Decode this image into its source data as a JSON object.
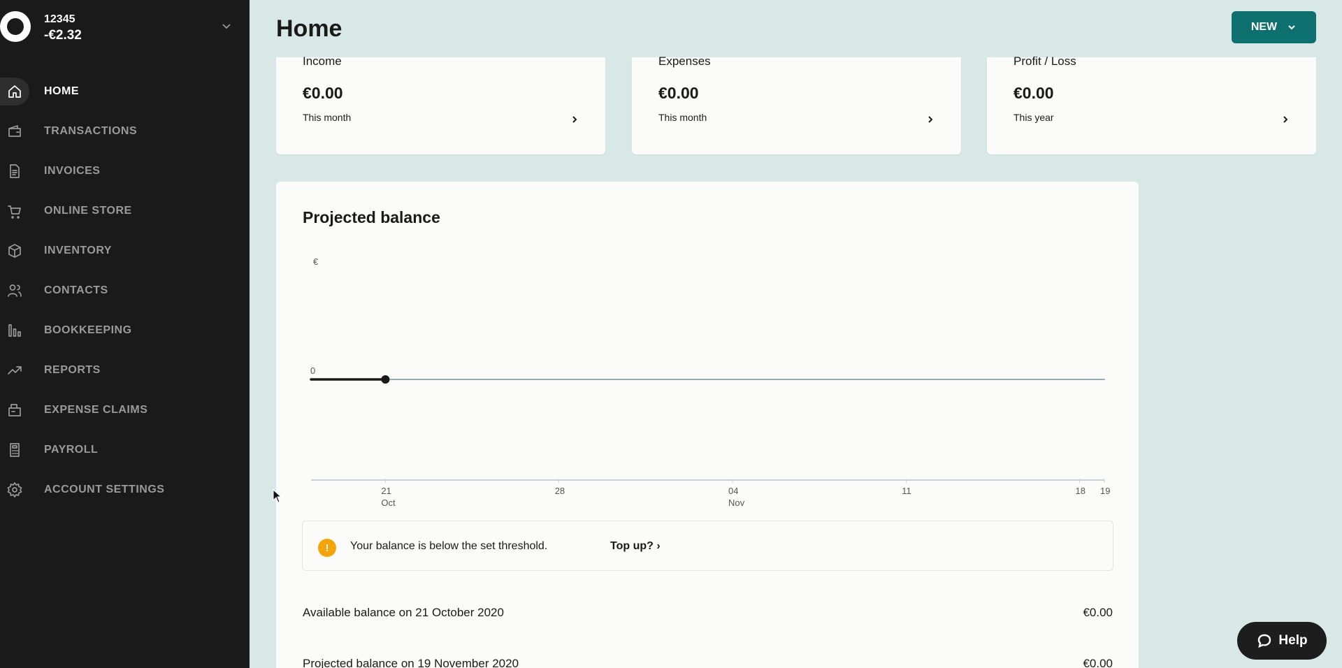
{
  "account": {
    "id": "12345",
    "balance": "-€2.32"
  },
  "nav": [
    {
      "label": "HOME",
      "icon": "home-icon",
      "active": true
    },
    {
      "label": "TRANSACTIONS",
      "icon": "wallet-icon",
      "active": false
    },
    {
      "label": "INVOICES",
      "icon": "document-icon",
      "active": false
    },
    {
      "label": "ONLINE STORE",
      "icon": "cart-icon",
      "active": false
    },
    {
      "label": "INVENTORY",
      "icon": "box-icon",
      "active": false
    },
    {
      "label": "CONTACTS",
      "icon": "people-icon",
      "active": false
    },
    {
      "label": "BOOKKEEPING",
      "icon": "bar-chart-icon",
      "active": false
    },
    {
      "label": "REPORTS",
      "icon": "trend-icon",
      "active": false
    },
    {
      "label": "EXPENSE CLAIMS",
      "icon": "receipt-wallet-icon",
      "active": false
    },
    {
      "label": "PAYROLL",
      "icon": "calculator-icon",
      "active": false
    },
    {
      "label": "ACCOUNT SETTINGS",
      "icon": "gear-icon",
      "active": false
    }
  ],
  "header": {
    "title": "Home",
    "new_label": "NEW"
  },
  "cards": [
    {
      "title": "Income",
      "value": "€0.00",
      "sub": "This month"
    },
    {
      "title": "Expenses",
      "value": "€0.00",
      "sub": "This month"
    },
    {
      "title": "Profit / Loss",
      "value": "€0.00",
      "sub": "This year"
    }
  ],
  "panel": {
    "title": "Projected balance",
    "alert_text": "Your balance is below the set threshold.",
    "alert_link": "Top up? ›",
    "rows": [
      {
        "label": "Available balance on 21 October 2020",
        "value": "€0.00"
      },
      {
        "label": "Projected balance on 19 November 2020",
        "value": "€0.00"
      }
    ]
  },
  "chart_data": {
    "type": "line",
    "title": "",
    "ylabel": "€",
    "xlabel": "",
    "x_ticks": [
      {
        "day": "21",
        "month": "Oct"
      },
      {
        "day": "28",
        "month": ""
      },
      {
        "day": "04",
        "month": "Nov"
      },
      {
        "day": "11",
        "month": ""
      },
      {
        "day": "18",
        "month": ""
      },
      {
        "day": "19",
        "month": ""
      }
    ],
    "y_ticks": [
      "0"
    ],
    "series": [
      {
        "values": [
          {
            "x": "2020-10-18",
            "y": 0
          },
          {
            "x": "2020-10-21",
            "y": 0
          }
        ]
      },
      {
        "values": [
          {
            "x": "2020-10-21",
            "y": 0
          },
          {
            "x": "2020-11-19",
            "y": 0
          }
        ]
      }
    ],
    "colors": {
      "actual": "#1a1a1a",
      "projected": "#9aacb4",
      "axis": "#c8d3d8"
    }
  },
  "help": {
    "label": "Help"
  }
}
